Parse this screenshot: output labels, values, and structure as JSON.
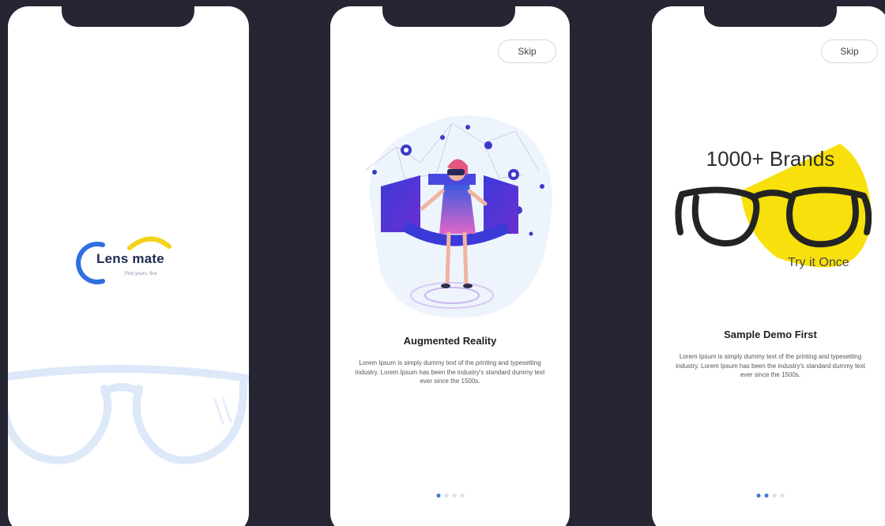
{
  "screens": [
    {
      "type": "splash",
      "logo": {
        "name": "Lens mate",
        "tagline": "Pick yours, fine",
        "colors": {
          "arc_blue": "#2f6fe0",
          "arc_yellow": "#f2d31a",
          "text": "#1e2a52"
        }
      }
    },
    {
      "type": "onboarding",
      "skip_label": "Skip",
      "title": "Augmented Reality",
      "body": "Lorem Ipsum is simply dummy text of the printing and typesetting industry. Lorem Ipsum has been the industry's standard dummy text ever since the 1500s.",
      "page_indicator": {
        "count": 4,
        "active_index": 0
      },
      "illustration": "vr-woman-illustration"
    },
    {
      "type": "onboarding",
      "skip_label": "Skip",
      "banner": {
        "headline": "1000+ Brands",
        "cta": "Try it Once",
        "accent_color": "#f7e00b"
      },
      "title": "Sample Demo First",
      "body": "Lorem Ipsum is simply dummy text of the printing and typesetting industry. Lorem Ipsum has been the industry's standard dummy text ever since the 1500s.",
      "page_indicator": {
        "count": 4,
        "active_index": 1
      },
      "illustration": "eyeglasses-illustration"
    }
  ],
  "colors": {
    "background": "#252533",
    "phone": "#ffffff",
    "indicator_active": "#3a78d6",
    "indicator_inactive": "#d9dfe9"
  }
}
